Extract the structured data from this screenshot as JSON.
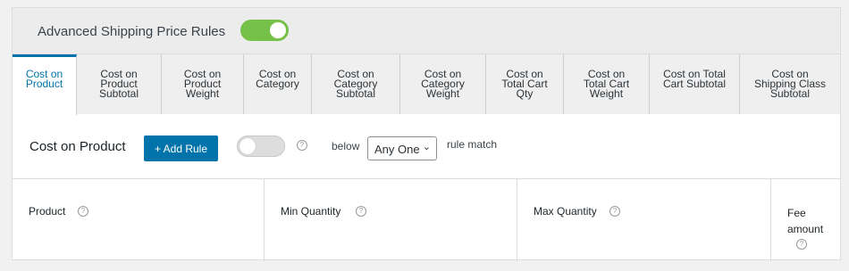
{
  "header": {
    "title": "Advanced Shipping Price Rules",
    "toggle_on": true
  },
  "tabs": [
    {
      "label": [
        "Cost on",
        "Product"
      ],
      "active": true
    },
    {
      "label": [
        "Cost on",
        "Product",
        "Subtotal"
      ],
      "active": false
    },
    {
      "label": [
        "Cost on",
        "Product",
        "Weight"
      ],
      "active": false
    },
    {
      "label": [
        "Cost on",
        "Category"
      ],
      "active": false
    },
    {
      "label": [
        "Cost on",
        "Category",
        "Subtotal"
      ],
      "active": false
    },
    {
      "label": [
        "Cost on",
        "Category",
        "Weight"
      ],
      "active": false
    },
    {
      "label": [
        "Cost on",
        "Total Cart",
        "Qty"
      ],
      "active": false
    },
    {
      "label": [
        "Cost on",
        "Total Cart",
        "Weight"
      ],
      "active": false
    },
    {
      "label": [
        "Cost on Total",
        "Cart Subtotal"
      ],
      "active": false
    },
    {
      "label": [
        "Cost on",
        "Shipping Class",
        "Subtotal"
      ],
      "active": false
    }
  ],
  "section": {
    "title": "Cost on Product",
    "add_rule_label": "+ Add Rule",
    "toggle_on": false,
    "below_label": "below",
    "match_select": "Any One",
    "rule_match_label": "rule match"
  },
  "columns": [
    {
      "label": "Product"
    },
    {
      "label": "Min Quantity"
    },
    {
      "label": "Max Quantity"
    },
    {
      "label": "Fee amount"
    }
  ],
  "colors": {
    "accent": "#0073aa",
    "toggle_on": "#75c14a"
  }
}
